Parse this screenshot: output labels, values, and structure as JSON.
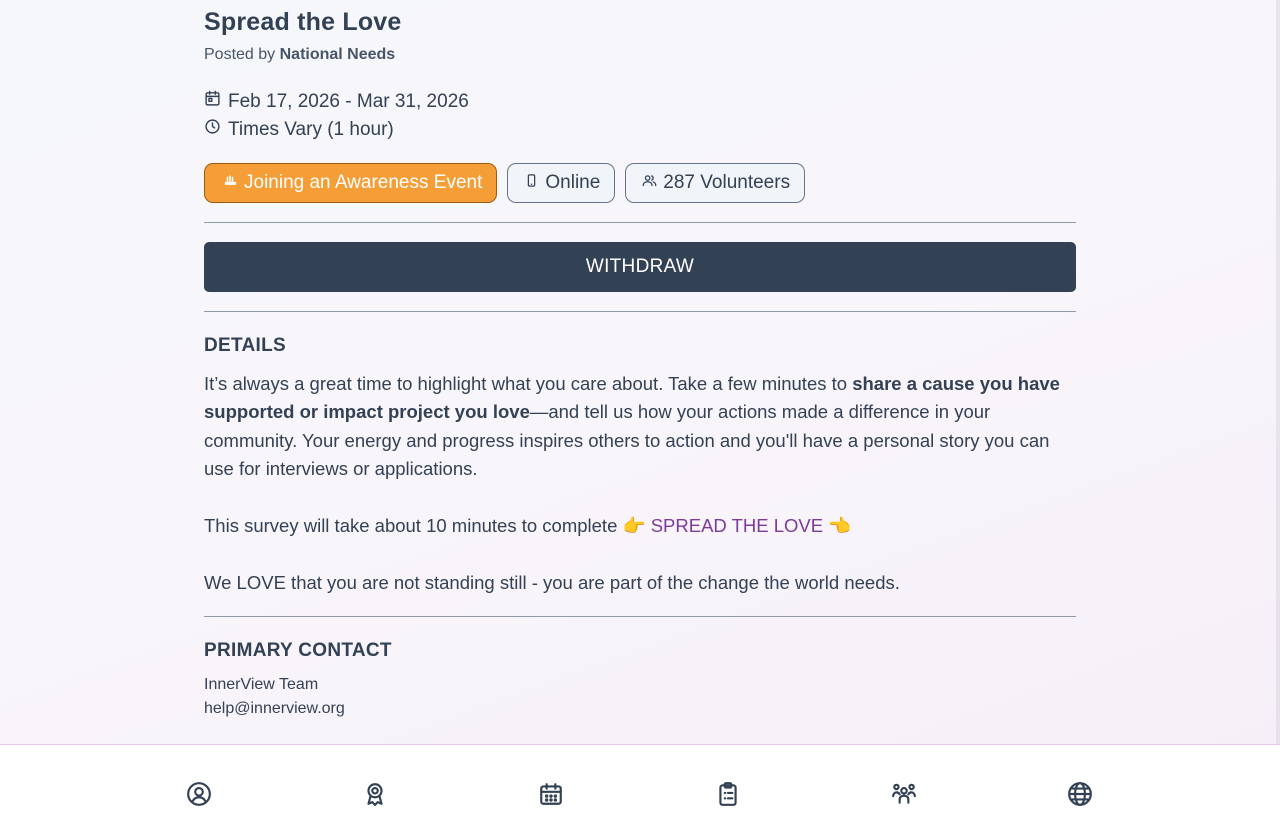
{
  "event": {
    "title": "Spread the Love",
    "posted_by_prefix": "Posted by",
    "posted_by_org": "National Needs",
    "date_range": "Feb 17, 2026 - Mar 31, 2026",
    "time": "Times Vary (1 hour)"
  },
  "tags": {
    "category": "Joining an Awareness Event",
    "location": "Online",
    "volunteers": "287 Volunteers"
  },
  "actions": {
    "withdraw_label": "WITHDRAW"
  },
  "details": {
    "heading": "DETAILS",
    "p1_start": "It’s always a great time to highlight what you care about. Take a few minutes to ",
    "p1_bold": "share a cause you have supported or impact project you love",
    "p1_end": "—and tell us how your actions made a difference in your community. Your energy and progress inspires others to action and you'll have a personal story you can use for interviews or applications.",
    "survey_text": "This survey will take about 10 minutes to complete 👉 ",
    "survey_link": "SPREAD THE LOVE",
    "survey_end": " 👈",
    "closing": "We LOVE that you are not standing still - you are part of the change the world needs."
  },
  "contact": {
    "heading": "PRIMARY CONTACT",
    "name": "InnerView Team",
    "email": "help@innerview.org"
  },
  "nav": {
    "items": [
      "profile-icon",
      "award-icon",
      "calendar-icon",
      "clipboard-icon",
      "people-icon",
      "globe-icon"
    ]
  },
  "colors": {
    "primary_dark": "#334155",
    "accent_orange": "#f59e37",
    "link_purple": "#7e3a9a"
  }
}
